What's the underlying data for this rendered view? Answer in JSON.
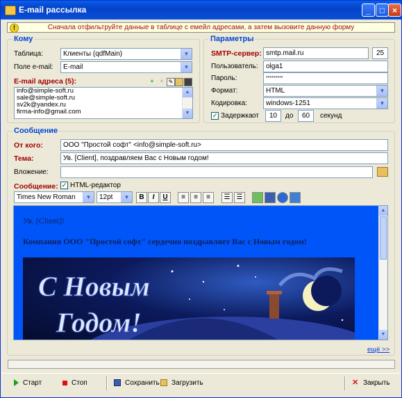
{
  "window": {
    "title": "E-mail рассылка"
  },
  "hint": "Сначала отфильтруйте данные в таблице с емейл адресами, а затем вызовите данную форму",
  "to": {
    "legend": "Кому",
    "table_label": "Таблица:",
    "table_value": "Клиенты (qdfMain)",
    "email_field_label": "Поле e-mail:",
    "email_field_value": "E-mail",
    "addresses_label": "E-mail адреса (5):",
    "addresses": [
      "info@simple-soft.ru",
      "sale@simple-soft.ru",
      "sv2k@yandex.ru",
      "firma-info@gmail.com"
    ]
  },
  "params": {
    "legend": "Параметры",
    "smtp_label": "SMTP-сервер:",
    "smtp_value": "smtp.mail.ru",
    "port_value": "25",
    "user_label": "Пользователь:",
    "user_value": "olga1",
    "password_label": "Пароль:",
    "password_value": "*********",
    "format_label": "Формат:",
    "format_value": "HTML",
    "encoding_label": "Кодировка:",
    "encoding_value": "windows-1251",
    "delay_label": "Задержка",
    "delay_from_label": "от",
    "delay_from": "10",
    "delay_to_label": "до",
    "delay_to": "60",
    "delay_unit": "секунд"
  },
  "message": {
    "legend": "Сообщение",
    "from_label": "От кого:",
    "from_value": "ООО \"Простой софт\" <info@simple-soft.ru>",
    "subject_label": "Тема:",
    "subject_value": "Ув. [Client], поздравляем Вас с Новым годом!",
    "attachment_label": "Вложение:",
    "attachment_value": "",
    "body_label": "Сообщение:",
    "html_editor_label": "HTML-редактор",
    "font_value": "Times New Roman",
    "size_value": "12pt",
    "body_line1": "Ув. [Client]!",
    "body_line2": "Компания ООО \"Простой софт\" сердечно поздравляет Вас с Новым годом!",
    "card_text_line1": "С Новым",
    "card_text_line2": "Годом!",
    "more_link": "ещё >>"
  },
  "buttons": {
    "start": "Старт",
    "stop": "Стоп",
    "save": "Сохранить",
    "load": "Загрузить",
    "close": "Закрыть"
  },
  "colors": {
    "title_bar": "#0a4fd6",
    "legend": "#0046d5",
    "required_label": "#a10000",
    "editor_bg": "#0055f8"
  }
}
